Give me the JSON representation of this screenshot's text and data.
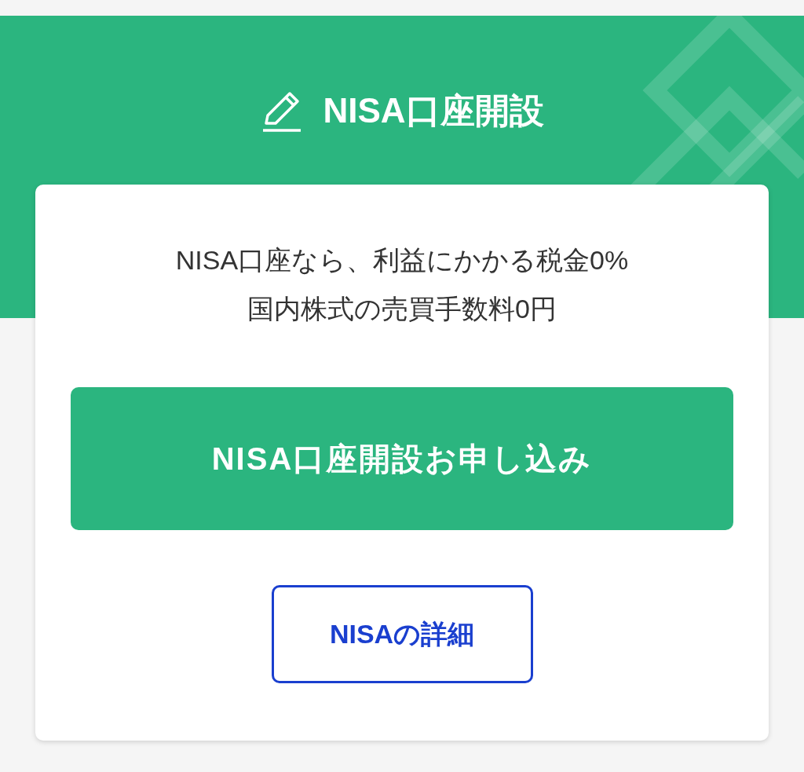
{
  "header": {
    "title": "NISA口座開設"
  },
  "card": {
    "lines": [
      "NISA口座なら、利益にかかる税金0%",
      "国内株式の売買手数料0円"
    ],
    "primary_button": "NISA口座開設お申し込み",
    "secondary_button": "NISAの詳細"
  }
}
